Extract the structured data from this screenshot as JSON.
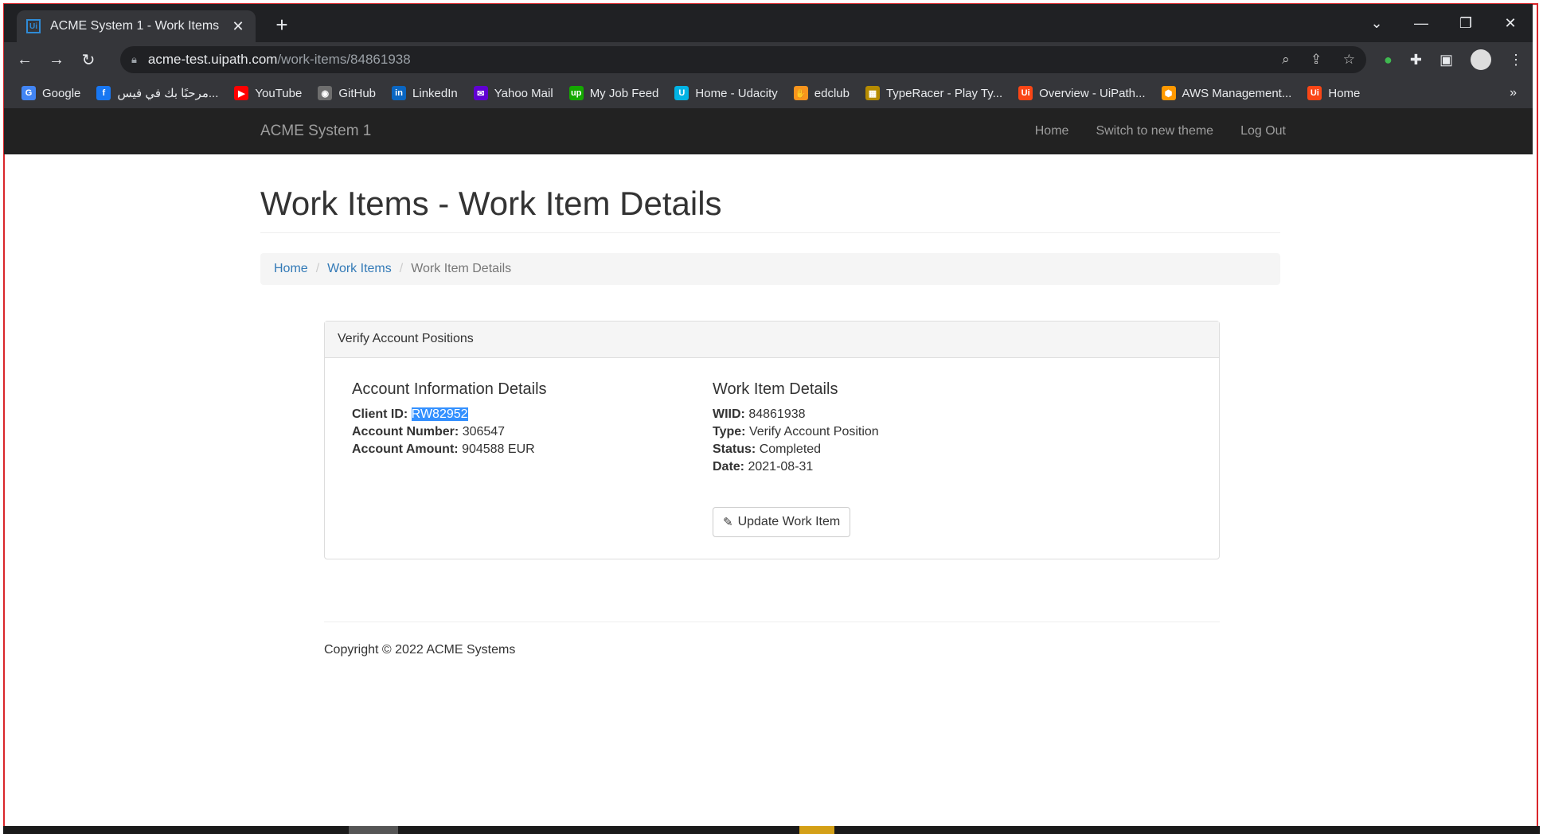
{
  "browser": {
    "tab_title": "ACME System 1 - Work Items",
    "tab_favicon": "Ui",
    "url_host": "acme-test.uipath.com",
    "url_path": "/work-items/84861938",
    "bookmarks": [
      {
        "label": "Google",
        "icon": "google-icon",
        "color": "#4285f4",
        "glyph": "G"
      },
      {
        "label": "مرحبًا بك في فيس...",
        "icon": "facebook-icon",
        "color": "#1877f2",
        "glyph": "f"
      },
      {
        "label": "YouTube",
        "icon": "youtube-icon",
        "color": "#ff0000",
        "glyph": "▶"
      },
      {
        "label": "GitHub",
        "icon": "github-icon",
        "color": "#6e6e6e",
        "glyph": "◉"
      },
      {
        "label": "LinkedIn",
        "icon": "linkedin-icon",
        "color": "#0a66c2",
        "glyph": "in"
      },
      {
        "label": "Yahoo Mail",
        "icon": "yahoo-mail-icon",
        "color": "#6001d2",
        "glyph": "✉"
      },
      {
        "label": "My Job Feed",
        "icon": "upwork-icon",
        "color": "#14a800",
        "glyph": "up"
      },
      {
        "label": "Home - Udacity",
        "icon": "udacity-icon",
        "color": "#02b3e4",
        "glyph": "U"
      },
      {
        "label": "edclub",
        "icon": "edclub-icon",
        "color": "#f7941d",
        "glyph": "✋"
      },
      {
        "label": "TypeRacer - Play Ty...",
        "icon": "typeracer-icon",
        "color": "#b58b00",
        "glyph": "▦"
      },
      {
        "label": "Overview - UiPath...",
        "icon": "uipath-icon",
        "color": "#fa4616",
        "glyph": "Ui"
      },
      {
        "label": "AWS Management...",
        "icon": "aws-icon",
        "color": "#ff9900",
        "glyph": "⬢"
      },
      {
        "label": "Home",
        "icon": "uipath-icon",
        "color": "#fa4616",
        "glyph": "Ui"
      }
    ]
  },
  "navbar": {
    "brand": "ACME System 1",
    "links": [
      "Home",
      "Switch to new theme",
      "Log Out"
    ]
  },
  "page": {
    "title": "Work Items - Work Item Details",
    "breadcrumb": [
      "Home",
      "Work Items",
      "Work Item Details"
    ]
  },
  "panel": {
    "heading": "Verify Account Positions",
    "account": {
      "title": "Account Information Details",
      "client_id_label": "Client ID:",
      "client_id": "RW82952",
      "account_number_label": "Account Number:",
      "account_number": "306547",
      "account_amount_label": "Account Amount:",
      "account_amount": "904588 EUR"
    },
    "work_item": {
      "title": "Work Item Details",
      "wiid_label": "WIID:",
      "wiid": "84861938",
      "type_label": "Type:",
      "type": "Verify Account Position",
      "status_label": "Status:",
      "status": "Completed",
      "date_label": "Date:",
      "date": "2021-08-31"
    },
    "update_button": "Update Work Item"
  },
  "footer": {
    "copyright": "Copyright © 2022 ACME Systems"
  }
}
